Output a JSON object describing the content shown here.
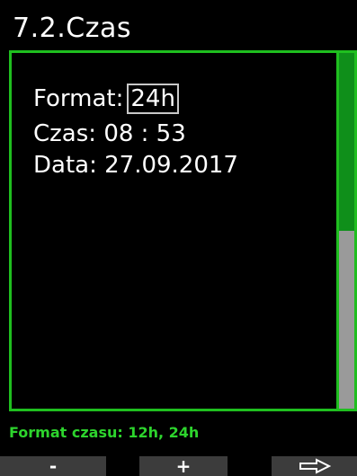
{
  "header": {
    "title": "7.2.Czas"
  },
  "settings": {
    "format_label": "Format:",
    "format_value": "24h",
    "time_label": "Czas:",
    "time_value": "08 : 53",
    "date_label": "Data:",
    "date_value": "27.09.2017"
  },
  "hint": {
    "text": "Format czasu: 12h, 24h"
  },
  "footer": {
    "minus_label": "-",
    "plus_label": "+",
    "next_icon": "right-arrow-icon"
  },
  "colors": {
    "accent": "#1fbf1f",
    "hint_text": "#2dd42d",
    "scroll_thumb": "#0f8f1a",
    "scroll_track": "#9a9a9a",
    "button_bg": "#3c3c3c"
  }
}
